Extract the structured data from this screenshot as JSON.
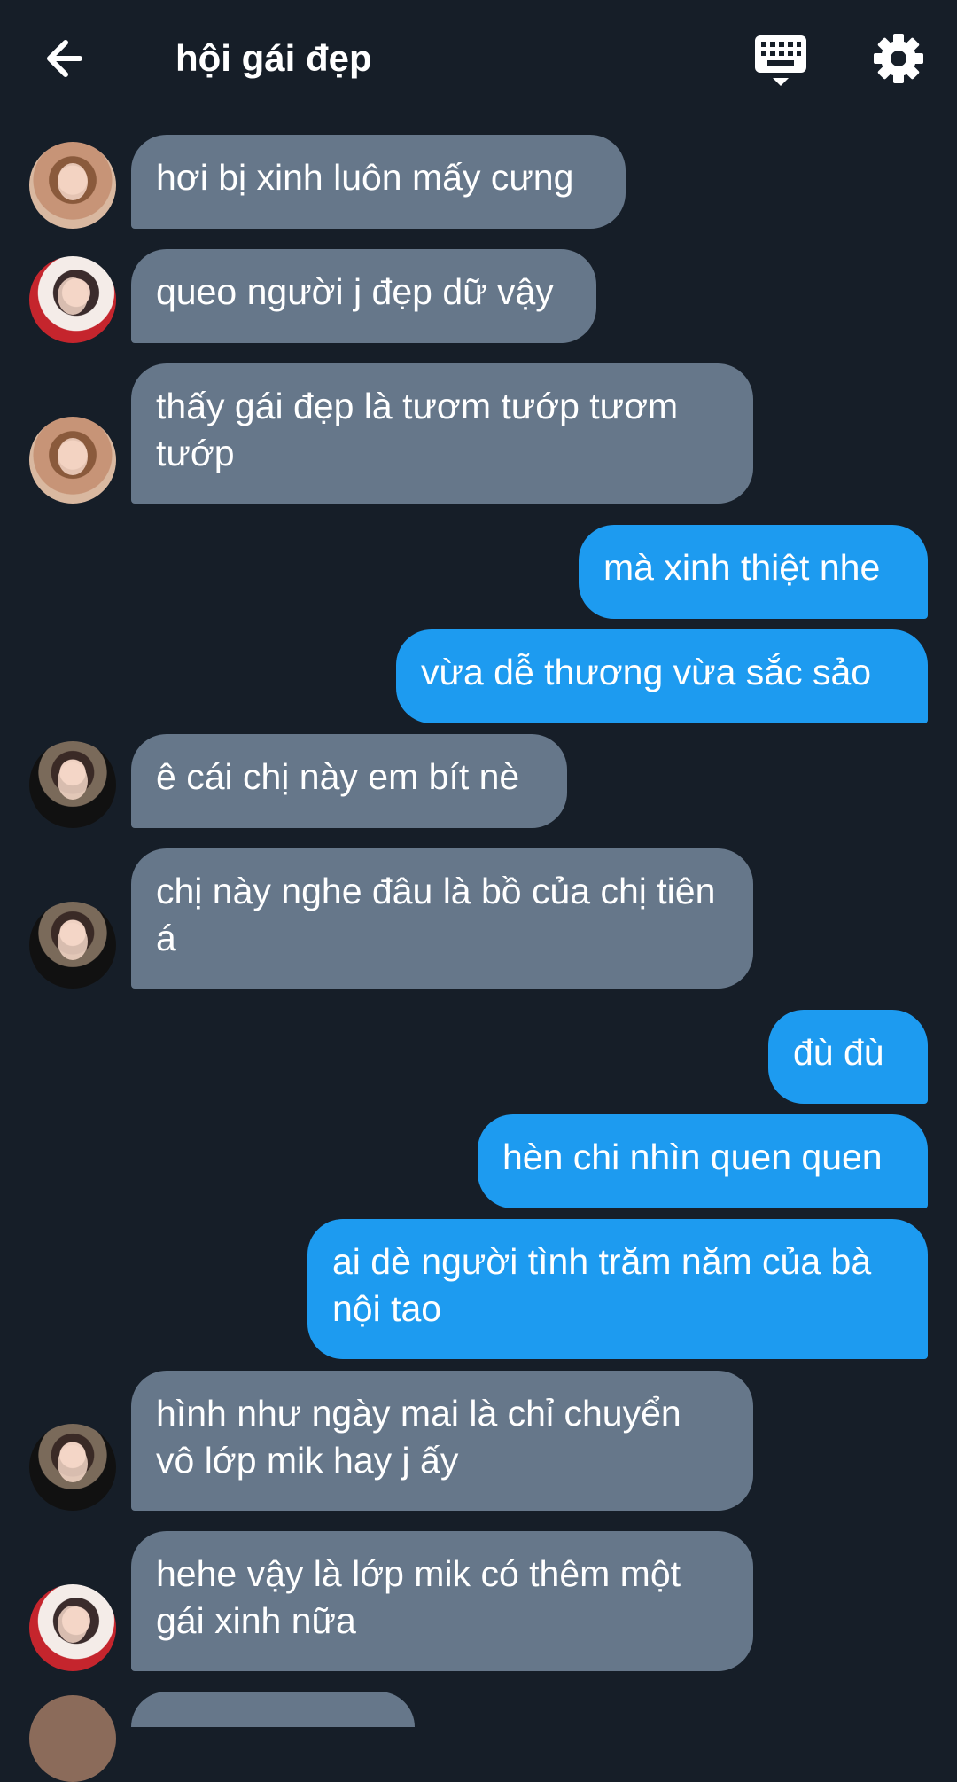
{
  "header": {
    "title": "hội gái đẹp",
    "icons": {
      "back": "arrow-left-icon",
      "keyboard": "keyboard-icon",
      "settings": "gear-icon"
    }
  },
  "colors": {
    "background": "#161e28",
    "incoming_bubble": "#66778a",
    "outgoing_bubble": "#1d9bf0",
    "text": "#ffffff"
  },
  "messages": [
    {
      "direction": "incoming",
      "sender_avatar": "avatar-1",
      "text": "hơi bị xinh luôn mấy cưng"
    },
    {
      "direction": "incoming",
      "sender_avatar": "avatar-2",
      "text": "queo người j đẹp dữ vậy"
    },
    {
      "direction": "incoming",
      "sender_avatar": "avatar-1",
      "text": "thấy gái đẹp là tươm tướp tươm tướp"
    },
    {
      "direction": "outgoing",
      "text": "mà xinh thiệt nhe"
    },
    {
      "direction": "outgoing",
      "text": "vừa dễ thương vừa sắc sảo"
    },
    {
      "direction": "incoming",
      "sender_avatar": "avatar-3",
      "text": "ê cái chị này em bít nè"
    },
    {
      "direction": "incoming",
      "sender_avatar": "avatar-3",
      "text": "chị này nghe đâu là bồ của chị tiên á"
    },
    {
      "direction": "outgoing",
      "text": "đù đù"
    },
    {
      "direction": "outgoing",
      "text": "hèn chi nhìn quen quen"
    },
    {
      "direction": "outgoing",
      "text": "ai dè người tình trăm năm của bà nội tao"
    },
    {
      "direction": "incoming",
      "sender_avatar": "avatar-3",
      "text": "hình như ngày mai là chỉ chuyển vô lớp mik hay j ấy"
    },
    {
      "direction": "incoming",
      "sender_avatar": "avatar-2",
      "text": "hehe vậy là lớp mik có thêm một gái xinh nữa"
    }
  ]
}
